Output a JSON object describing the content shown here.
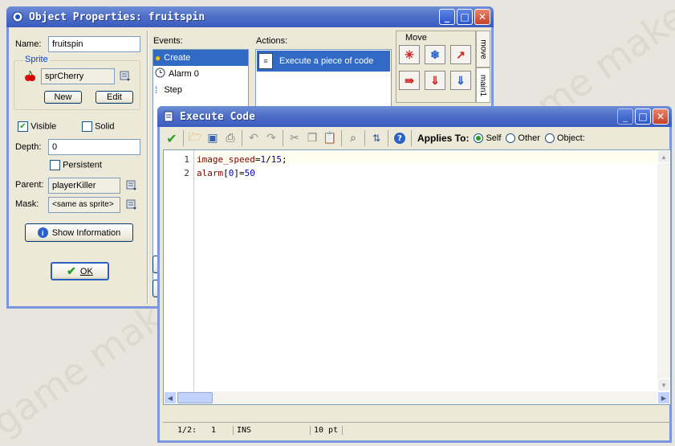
{
  "watermark": "game maker",
  "obj": {
    "title": "Object Properties: fruitspin",
    "name_label": "Name:",
    "name_value": "fruitspin",
    "sprite_caption": "Sprite",
    "sprite_value": "sprCherry",
    "new_label": "New",
    "edit_label": "Edit",
    "visible_label": "Visible",
    "solid_label": "Solid",
    "depth_label": "Depth:",
    "depth_value": "0",
    "persistent_label": "Persistent",
    "parent_label": "Parent:",
    "parent_value": "playerKiller",
    "mask_label": "Mask:",
    "mask_value": "<same as sprite>",
    "show_info_label": "Show Information",
    "ok_label": "OK",
    "events_label": "Events:",
    "events": [
      {
        "label": "Create",
        "icon": "lightbulb-icon"
      },
      {
        "label": "Alarm 0",
        "icon": "clock-icon"
      },
      {
        "label": "Step",
        "icon": "footsteps-icon"
      }
    ],
    "actions_label": "Actions:",
    "actions": [
      "Execute a piece of code"
    ],
    "panel_label": "Move",
    "tabs": [
      "move",
      "main1"
    ]
  },
  "code": {
    "title": "Execute Code",
    "applies_label": "Applies To:",
    "self_label": "Self",
    "other_label": "Other",
    "object_label": "Object:",
    "lines": [
      {
        "n": "1",
        "parts": [
          {
            "t": "image_speed",
            "c": "kw"
          },
          {
            "t": "=",
            "c": ""
          },
          {
            "t": "1",
            "c": "num"
          },
          {
            "t": "/",
            "c": ""
          },
          {
            "t": "15",
            "c": "num"
          },
          {
            "t": ";",
            "c": ""
          }
        ]
      },
      {
        "n": "2",
        "parts": [
          {
            "t": "alarm",
            "c": "kw"
          },
          {
            "t": "[",
            "c": ""
          },
          {
            "t": "0",
            "c": "num"
          },
          {
            "t": "]",
            "c": ""
          },
          {
            "t": "=",
            "c": ""
          },
          {
            "t": "50",
            "c": "num"
          }
        ]
      }
    ],
    "status": {
      "pos": "1/2:",
      "col": "1",
      "mode": "INS",
      "size": "10 pt"
    }
  },
  "colors": {
    "title_blue": "#3b5cbf",
    "selection": "#316ac5",
    "keyword": "#800000",
    "number": "#0000c0"
  }
}
